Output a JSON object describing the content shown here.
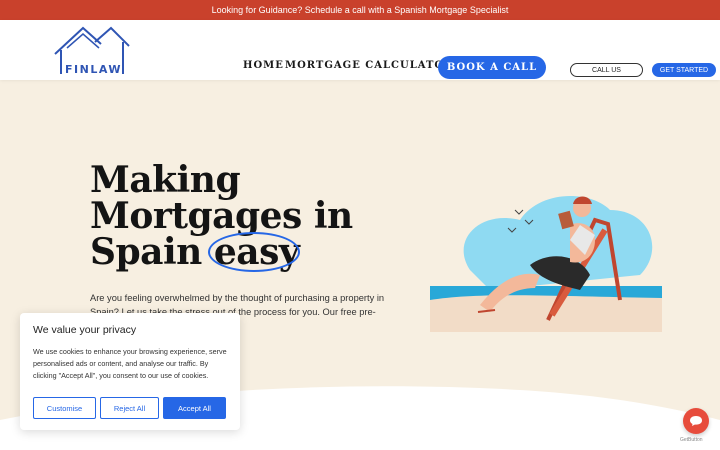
{
  "topbar": {
    "text": "Looking for Guidance? Schedule a call with a Spanish Mortgage Specialist"
  },
  "header": {
    "logo_text": "FINLAW",
    "nav": {
      "home": "HOME",
      "calculator": "MORTGAGE CALCULATOR"
    },
    "book_label": "BOOK A CALL",
    "call_us_label": "CALL US",
    "get_started_label": "GET STARTED"
  },
  "hero": {
    "title_line1": "Making",
    "title_line2": "Mortgages in",
    "title_line3": "Spain",
    "title_highlight": "easy",
    "text": "Are you feeling overwhelmed by the thought of purchasing a property in Spain? Let us take the stress out of the process for you. Our free pre-                                        ing the mortgage solution that"
  },
  "cookie": {
    "title": "We value your privacy",
    "body": "We use cookies to enhance your browsing experience, serve personalised ads or content, and analyse our traffic. By clicking \"Accept All\", you consent to our use of cookies.",
    "customise": "Customise",
    "reject": "Reject All",
    "accept": "Accept All"
  },
  "chat": {
    "brand": "GetButton"
  },
  "colors": {
    "accent": "#2667e6",
    "topbar": "#c9412c",
    "background": "#f7efe1",
    "chat": "#e74c3c"
  }
}
